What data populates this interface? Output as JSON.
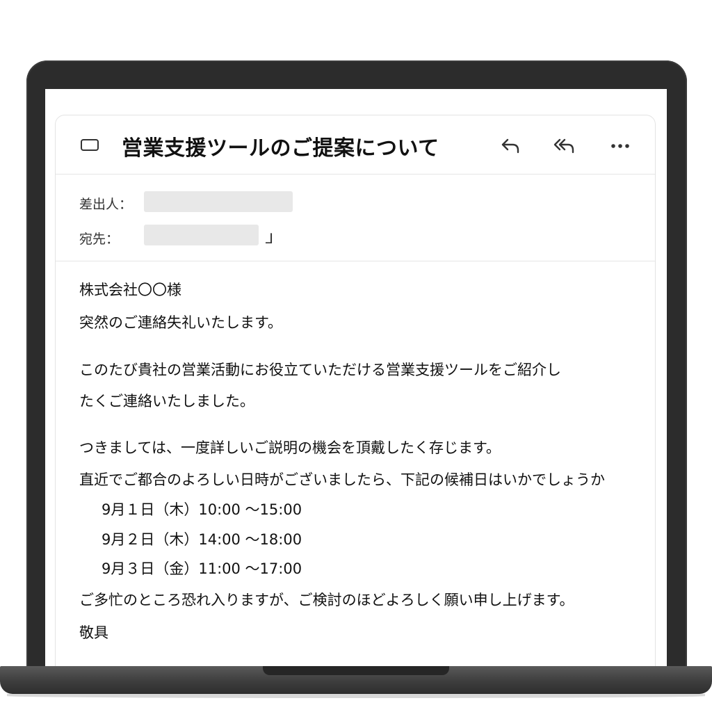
{
  "email": {
    "subject": "営業支援ツールのご提案について",
    "actions": {
      "reply_icon": "reply-icon",
      "reply_all_icon": "reply-all-icon",
      "more_icon": "more-horizontal-icon"
    },
    "from_label": "差出人：",
    "to_label": "宛先：",
    "expand_icon_glyph": "⅃",
    "body": {
      "salutation": "株式会社〇〇様",
      "greeting": "突然のご連絡失礼いたします。",
      "para1_line1": "このたび貴社の営業活動にお役立ていただける営業支援ツールをご紹介し",
      "para1_line2": "たくご連絡いたしました。",
      "para2_line1": "つきましては、一度詳しいご説明の機会を頂戴したく存じます。",
      "para2_line2": "直近でご都合のよろしい日時がございましたら、下記の候補日はいかでしょうか",
      "schedule": [
        "9月１日（木）10:00 ～15:00",
        "9月２日（木）14:00 ～18:00",
        "9月３日（金）11:00 ～17:00"
      ],
      "closing": "ご多忙のところ恐れ入りますが、ご検討のほどよろしく願い申し上げます。",
      "signoff": "敬具"
    }
  }
}
